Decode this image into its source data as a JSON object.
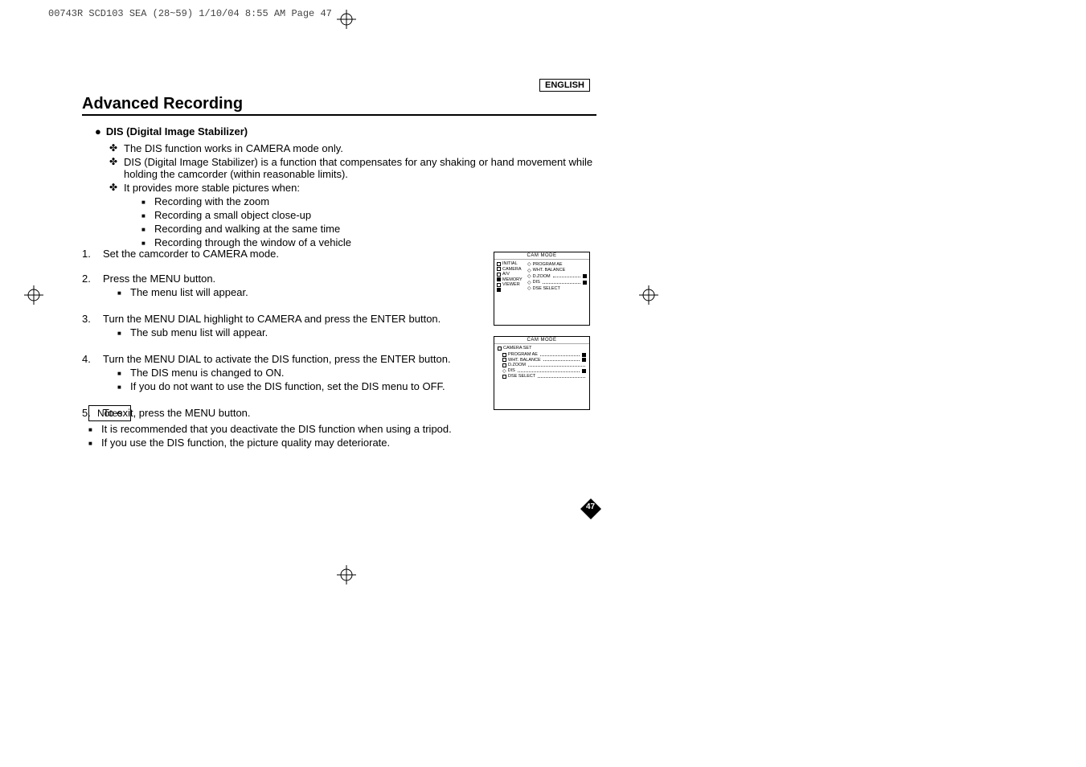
{
  "print_header": "00743R SCD103 SEA (28~59)  1/10/04 8:55 AM  Page 47",
  "language_tag": "ENGLISH",
  "title": "Advanced Recording",
  "feature_title": "DIS (Digital Image Stabilizer)",
  "feature_points": [
    "The DIS function works in CAMERA mode only.",
    "DIS (Digital Image Stabilizer) is a function that compensates for any shaking or hand movement while holding the camcorder (within reasonable limits).",
    "It provides more stable pictures when:"
  ],
  "stable_examples": [
    "Recording with the zoom",
    "Recording a small object close-up",
    "Recording and walking at the same time",
    "Recording through the window of a vehicle"
  ],
  "steps": [
    {
      "num": "1.",
      "text": "Set the camcorder to CAMERA mode.",
      "sub": []
    },
    {
      "num": "2.",
      "text": "Press the MENU button.",
      "sub": [
        "The menu list will appear."
      ]
    },
    {
      "num": "3.",
      "text": "Turn the MENU DIAL highlight to CAMERA and press the ENTER button.",
      "sub": [
        "The sub menu list will appear."
      ]
    },
    {
      "num": "4.",
      "text": "Turn the MENU DIAL to activate the DIS function, press the ENTER button.",
      "sub": [
        "The DIS menu is changed to ON.",
        "If you do not want to use the DIS function, set the DIS menu to OFF."
      ]
    },
    {
      "num": "5.",
      "text": "To exit, press the MENU button.",
      "sub": []
    }
  ],
  "notes_label": "Notes",
  "notes": [
    "It is recommended that you deactivate the DIS function when using a tripod.",
    "If you use the DIS function, the picture quality may deteriorate."
  ],
  "screen1": {
    "title": "CAM MODE",
    "left_menu": [
      "INITIAL",
      "CAMERA",
      "A/V",
      "MEMORY",
      "VIEWER"
    ],
    "right_menu": [
      "PROGRAM AE",
      "WHT. BALANCE",
      "D.ZOOM",
      "DIS",
      "DSE SELECT"
    ]
  },
  "screen2": {
    "title": "CAM MODE",
    "header": "CAMERA SET",
    "items": [
      "PROGRAM AE",
      "WHT. BALANCE",
      "D.ZOOM",
      "DIS",
      "DSE SELECT"
    ]
  },
  "page_number": "47"
}
